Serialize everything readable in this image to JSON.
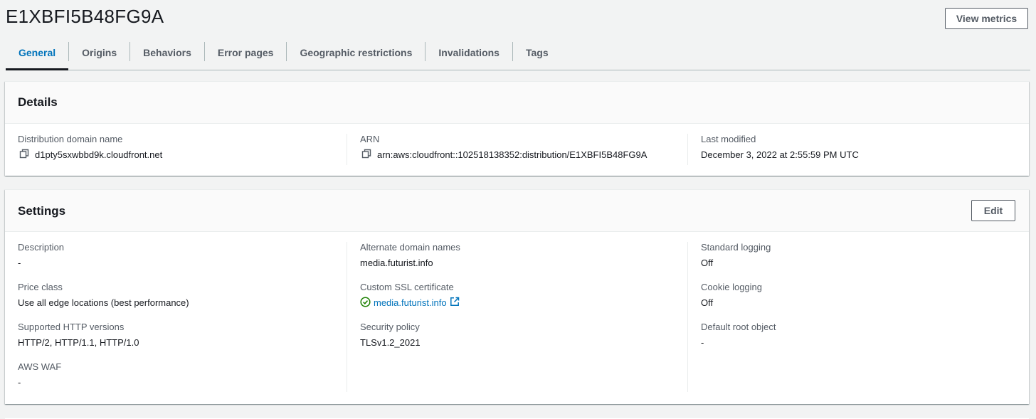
{
  "header": {
    "title": "E1XBFI5B48FG9A",
    "view_metrics_label": "View metrics"
  },
  "tabs": [
    {
      "label": "General",
      "active": true
    },
    {
      "label": "Origins"
    },
    {
      "label": "Behaviors"
    },
    {
      "label": "Error pages"
    },
    {
      "label": "Geographic restrictions"
    },
    {
      "label": "Invalidations"
    },
    {
      "label": "Tags"
    }
  ],
  "details": {
    "title": "Details",
    "domain_label": "Distribution domain name",
    "domain_value": "d1pty5sxwbbd9k.cloudfront.net",
    "arn_label": "ARN",
    "arn_value": "arn:aws:cloudfront::102518138352:distribution/E1XBFI5B48FG9A",
    "modified_label": "Last modified",
    "modified_value": "December 3, 2022 at 2:55:59 PM UTC"
  },
  "settings": {
    "title": "Settings",
    "edit_label": "Edit",
    "description_label": "Description",
    "description_value": "-",
    "price_class_label": "Price class",
    "price_class_value": "Use all edge locations (best performance)",
    "http_versions_label": "Supported HTTP versions",
    "http_versions_value": "HTTP/2, HTTP/1.1, HTTP/1.0",
    "waf_label": "AWS WAF",
    "waf_value": "-",
    "alt_domains_label": "Alternate domain names",
    "alt_domains_value": "media.futurist.info",
    "ssl_label": "Custom SSL certificate",
    "ssl_value": "media.futurist.info",
    "security_policy_label": "Security policy",
    "security_policy_value": "TLSv1.2_2021",
    "std_logging_label": "Standard logging",
    "std_logging_value": "Off",
    "cookie_logging_label": "Cookie logging",
    "cookie_logging_value": "Off",
    "root_object_label": "Default root object",
    "root_object_value": "-"
  },
  "colors": {
    "accent": "#0073bb",
    "success": "#1d8102",
    "background": "#f2f3f3"
  },
  "icons": [
    "copy-icon",
    "status-success-icon",
    "external-link-icon"
  ]
}
